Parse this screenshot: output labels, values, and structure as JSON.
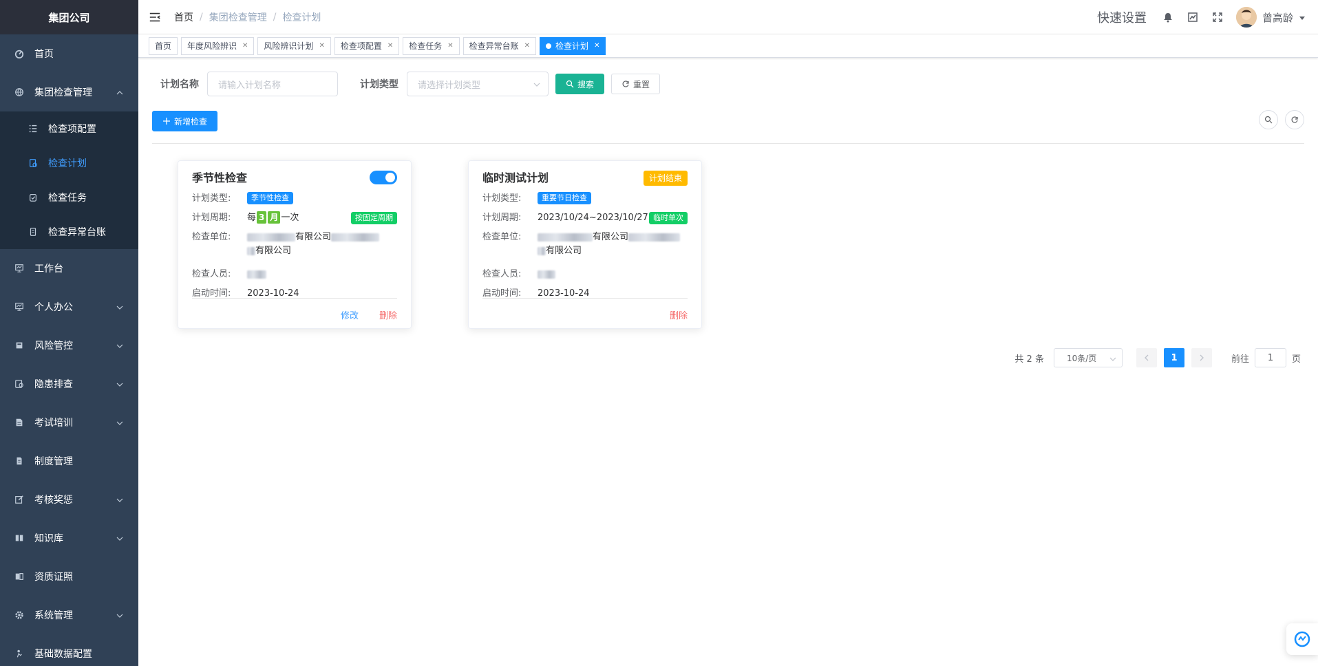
{
  "brand": "集团公司",
  "sidebar": {
    "items": [
      {
        "label": "首页",
        "icon": "dashboard-icon"
      },
      {
        "label": "集团检查管理",
        "icon": "globe-icon",
        "expanded": true
      },
      {
        "label": "检查项配置",
        "icon": "list-icon"
      },
      {
        "label": "检查计划",
        "icon": "plan-icon",
        "active": true
      },
      {
        "label": "检查任务",
        "icon": "task-icon"
      },
      {
        "label": "检查异常台账",
        "icon": "ledger-icon"
      },
      {
        "label": "工作台",
        "icon": "monitor-icon"
      },
      {
        "label": "个人办公",
        "icon": "monitor-icon"
      },
      {
        "label": "风险管控",
        "icon": "risk-icon"
      },
      {
        "label": "隐患排查",
        "icon": "hazard-icon"
      },
      {
        "label": "考试培训",
        "icon": "exam-icon"
      },
      {
        "label": "制度管理",
        "icon": "doc-icon"
      },
      {
        "label": "考核奖惩",
        "icon": "edit-icon"
      },
      {
        "label": "知识库",
        "icon": "book-icon"
      },
      {
        "label": "资质证照",
        "icon": "cert-icon"
      },
      {
        "label": "系统管理",
        "icon": "gear-icon"
      },
      {
        "label": "基础数据配置",
        "icon": "data-icon"
      }
    ]
  },
  "navbar": {
    "breadcrumb": [
      "首页",
      "集团检查管理",
      "检查计划"
    ],
    "quick_settings": "快速设置",
    "username": "曾高龄"
  },
  "tags": [
    {
      "label": "首页"
    },
    {
      "label": "年度风险辨识"
    },
    {
      "label": "风险辨识计划"
    },
    {
      "label": "检查项配置"
    },
    {
      "label": "检查任务"
    },
    {
      "label": "检查异常台账"
    },
    {
      "label": "检查计划",
      "active": true
    }
  ],
  "search": {
    "name_label": "计划名称",
    "name_placeholder": "请输入计划名称",
    "type_label": "计划类型",
    "type_placeholder": "请选择计划类型",
    "search_btn": "搜索",
    "reset_btn": "重置",
    "add_btn": "新增检查"
  },
  "cards": [
    {
      "title": "季节性检查",
      "type_key": "计划类型:",
      "type_val": "季节性检查",
      "cycle_key": "计划周期:",
      "cycle_pre": "每",
      "cycle_num": "3",
      "cycle_unit": "月",
      "cycle_post": "一次",
      "cycle_badge": "按固定周期",
      "unit_key": "检查单位:",
      "unit_val1": "有限公司",
      "unit_val2": "有限公司",
      "person_key": "检查人员:",
      "start_key": "启动时间:",
      "start_val": "2023-10-24",
      "edit": "修改",
      "del": "删除"
    },
    {
      "title": "临时测试计划",
      "status_badge": "计划结束",
      "type_key": "计划类型:",
      "type_val": "重要节日检查",
      "cycle_key": "计划周期:",
      "cycle_val": "2023/10/24~2023/10/27",
      "cycle_badge": "临时单次",
      "unit_key": "检查单位:",
      "unit_val1": "有限公司",
      "unit_val2": "有限公司",
      "person_key": "检查人员:",
      "start_key": "启动时间:",
      "start_val": "2023-10-24",
      "del": "删除"
    }
  ],
  "pager": {
    "total": "共 2 条",
    "size": "10条/页",
    "current": "1",
    "goto_pre": "前往",
    "goto_val": "1",
    "goto_post": "页"
  },
  "colors": {
    "sidebar_bg": "#304156",
    "primary": "#1890ff",
    "teal": "#1ab394",
    "green": "#13ce66",
    "orange": "#ffba00",
    "danger": "#f56c6c"
  }
}
